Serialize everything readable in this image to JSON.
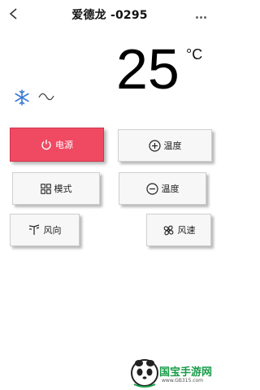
{
  "header": {
    "title": "爱德龙 -0295"
  },
  "temperature": {
    "value": "25",
    "unit": "°C"
  },
  "status_icons": [
    "snowflake-icon",
    "wave-icon"
  ],
  "buttons": {
    "power": {
      "label": "电源",
      "icon": "power-icon"
    },
    "temp_up": {
      "label": "温度",
      "icon": "plus-circle-icon"
    },
    "mode": {
      "label": "模式",
      "icon": "grid-icon"
    },
    "temp_down": {
      "label": "温度",
      "icon": "minus-circle-icon"
    },
    "wind_direction": {
      "label": "风向",
      "icon": "swing-icon"
    },
    "wind_speed": {
      "label": "风速",
      "icon": "fan-icon"
    }
  },
  "colors": {
    "power_button": "#ef4a62",
    "snowflake": "#3a7bd5"
  },
  "watermark": {
    "text": "国宝手游网",
    "url": "www.GB315.com"
  }
}
